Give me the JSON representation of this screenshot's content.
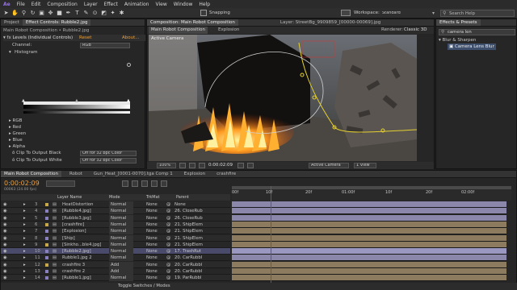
{
  "menu": {
    "items": [
      "File",
      "Edit",
      "Composition",
      "Layer",
      "Effect",
      "Animation",
      "View",
      "Window",
      "Help"
    ]
  },
  "toolbar": {
    "snapping": "Snapping",
    "workspace_label": "Workspace:",
    "workspace_value": "Standard",
    "search_placeholder": "Search Help"
  },
  "left_panel": {
    "tabs": [
      "Project",
      "Effect Controls: Rubble2.jpg"
    ],
    "breadcrumb": "Main Robot Composition • Rubble2.jpg",
    "effect_name": "Levels (Individual Controls)",
    "reset": "Reset",
    "about": "About...",
    "channel_label": "Channel:",
    "channel_value": "RGB",
    "histogram_label": "Histogram",
    "channels": [
      "RGB",
      "Red",
      "Green",
      "Blue",
      "Alpha"
    ],
    "clip_black_label": "Clip To Output Black",
    "clip_black_value": "Off for 32 bpc Color",
    "clip_white_label": "Clip To Output White",
    "clip_white_value": "Off for 32 bpc Color"
  },
  "viewer": {
    "tab_label": "Composition: Main Robot Composition",
    "layer_tab": "Layer: StreetBg_9909859_[00000-00069].jpg",
    "subtabs": [
      "Main Robot Composition",
      "Explosion"
    ],
    "renderer_label": "Renderer:",
    "renderer_value": "Classic 3D",
    "camera_label": "Active Camera",
    "zoom": "100%",
    "timecode": "0:00:02:09",
    "view_camera": "Active Camera",
    "view_count": "1 View"
  },
  "right_panel": {
    "tab": "Effects & Presets",
    "search_value": "camera len",
    "category": "Blur & Sharpen",
    "effect": "Camera Lens Blur"
  },
  "timeline": {
    "tabs": [
      "Main Robot Composition",
      "Robot",
      "Gun_Heat_[0001-0070].tga Comp 1",
      "Explosion",
      "crashfire"
    ],
    "timecode": "0:00:02:09",
    "fps_info": "00063 (24.00 fps)",
    "col_layer": "Layer Name",
    "col_mode": "Mode",
    "col_trkmat": "TrkMat",
    "col_parent": "Parent",
    "ticks": [
      "00f",
      "10f",
      "20f",
      "01:00f",
      "10f",
      "20f",
      "02:00f"
    ],
    "toggle_label": "Toggle Switches / Modes",
    "layers": [
      {
        "num": "3",
        "name": "HeatDistortion",
        "mode": "Normal",
        "trk": "None",
        "parent": "None"
      },
      {
        "num": "4",
        "name": "[Rubble4.jpg]",
        "mode": "Normal",
        "trk": "None",
        "parent": "26. CloseRub"
      },
      {
        "num": "5",
        "name": "[Rubble3.jpg]",
        "mode": "Normal",
        "trk": "None",
        "parent": "26. CloseRub"
      },
      {
        "num": "6",
        "name": "[crashfire]",
        "mode": "Normal",
        "trk": "None",
        "parent": "21. ShipElem"
      },
      {
        "num": "7",
        "name": "[Explosion]",
        "mode": "Normal",
        "trk": "None",
        "parent": "21. ShipElem"
      },
      {
        "num": "8",
        "name": "[Ship]",
        "mode": "Normal",
        "trk": "None",
        "parent": "21. ShipElem"
      },
      {
        "num": "9",
        "name": "[Sinkho...ble4.jpg]",
        "mode": "Normal",
        "trk": "None",
        "parent": "21. ShipElem"
      },
      {
        "num": "10",
        "name": "[Rubble2.jpg]",
        "mode": "Normal",
        "trk": "None",
        "parent": "17. TrashRut"
      },
      {
        "num": "11",
        "name": "Rubble1.jpg 2",
        "mode": "Normal",
        "trk": "None",
        "parent": "20. CarRubbl"
      },
      {
        "num": "12",
        "name": "crashfire 3",
        "mode": "Add",
        "trk": "None",
        "parent": "20. CarRubbl"
      },
      {
        "num": "13",
        "name": "crashfire 2",
        "mode": "Add",
        "trk": "None",
        "parent": "20. CarRubbl"
      },
      {
        "num": "14",
        "name": "[Rubble1.jpg]",
        "mode": "Normal",
        "trk": "None",
        "parent": "19. ParRubbl"
      }
    ]
  },
  "colors": {
    "accent": "#e8a040",
    "track_purple": "#8a87aa",
    "track_tan": "#8d7b60",
    "selected": "#4a4a6a"
  }
}
